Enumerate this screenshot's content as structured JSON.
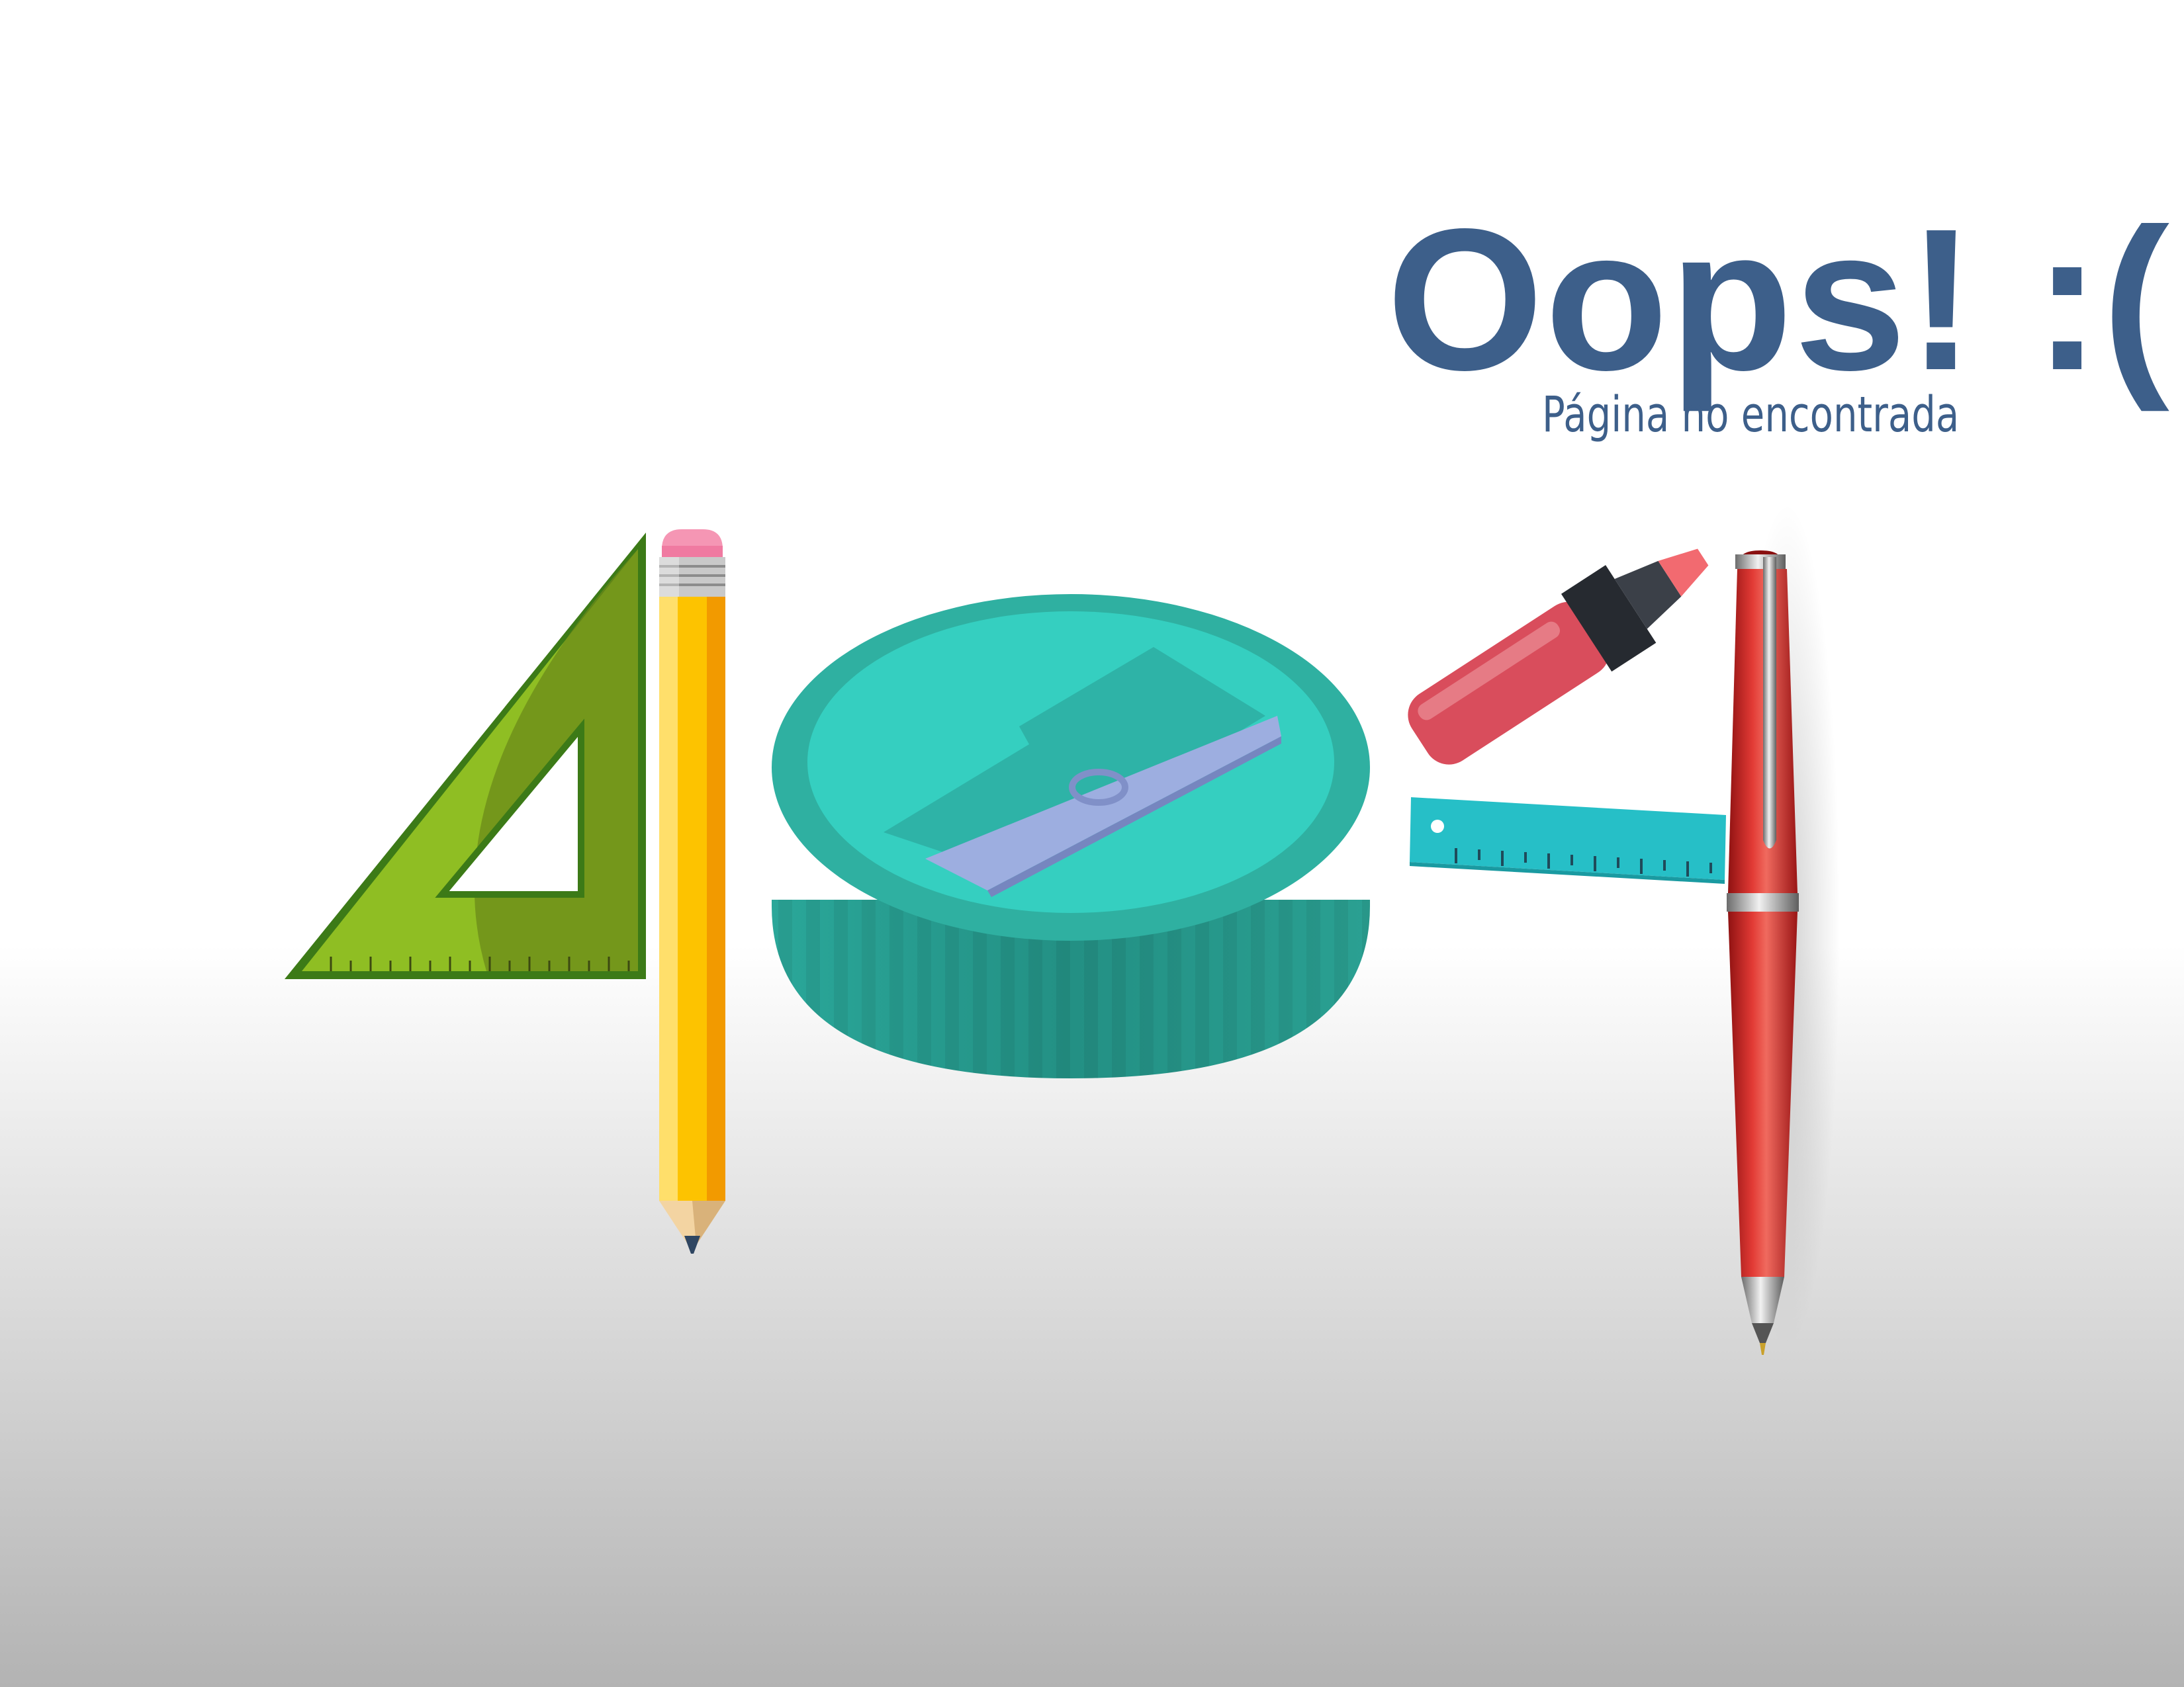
{
  "page": {
    "headline": "Oops! :(",
    "subheadline": "Página no encontrada"
  },
  "colors": {
    "headline": "#3d5f8a",
    "square_green": "#8fbe23",
    "square_dark": "#3c7a17",
    "pencil_yellow": "#fdc300",
    "pencil_eraser": "#f596b4",
    "sharpener_teal": "#35cfc0",
    "sharpener_side": "#2a9c8f",
    "blade": "#9daee0",
    "marker_red": "#d94d5c",
    "ruler_teal": "#26bfc7",
    "pen_red": "#d42a2a"
  },
  "icons": {
    "set_square": "set-square-icon",
    "pencil": "pencil-icon",
    "sharpener": "sharpener-icon",
    "highlighter": "highlighter-icon",
    "ruler": "ruler-icon",
    "pen": "pen-icon"
  }
}
